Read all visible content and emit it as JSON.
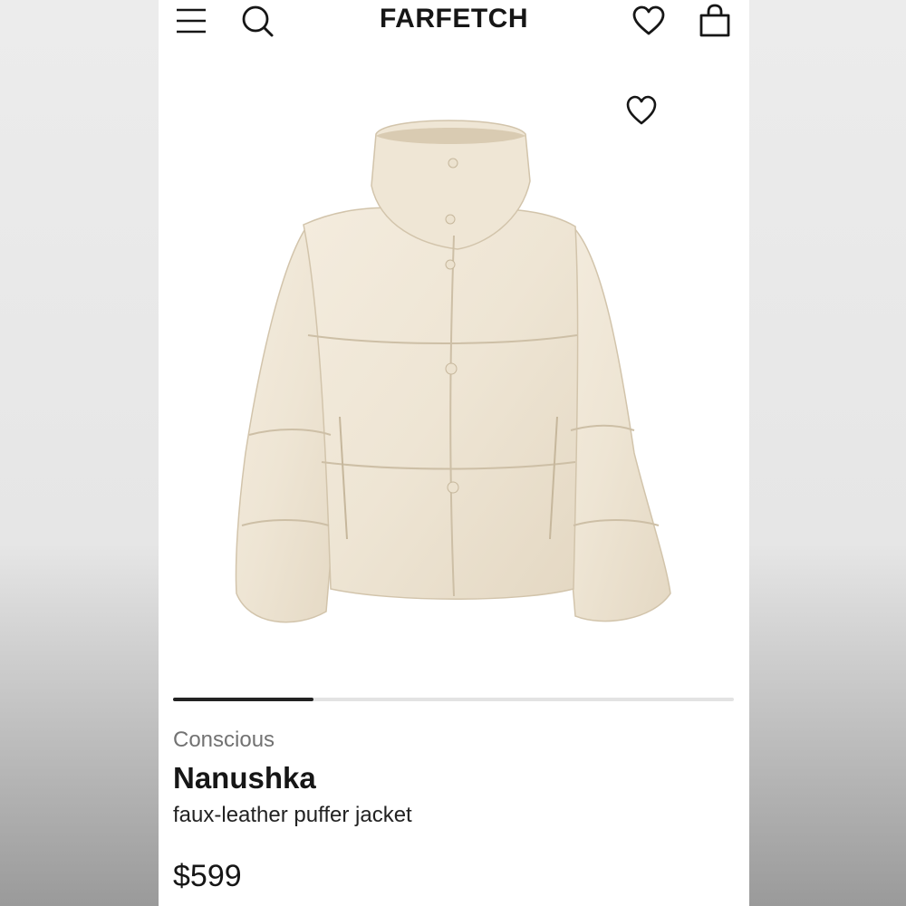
{
  "header": {
    "logo": "FARFETCH",
    "icons": [
      "menu-icon",
      "search-icon",
      "heart-icon",
      "shopping-bag-icon"
    ]
  },
  "product": {
    "tag": "Conscious",
    "brand": "Nanushka",
    "description": "faux-leather puffer jacket",
    "price": "$599",
    "image_colors": {
      "jacket": "#efe6d6",
      "shadow": "#dccfb8",
      "seam": "#cdbfa6"
    },
    "carousel_progress": 0.25
  }
}
